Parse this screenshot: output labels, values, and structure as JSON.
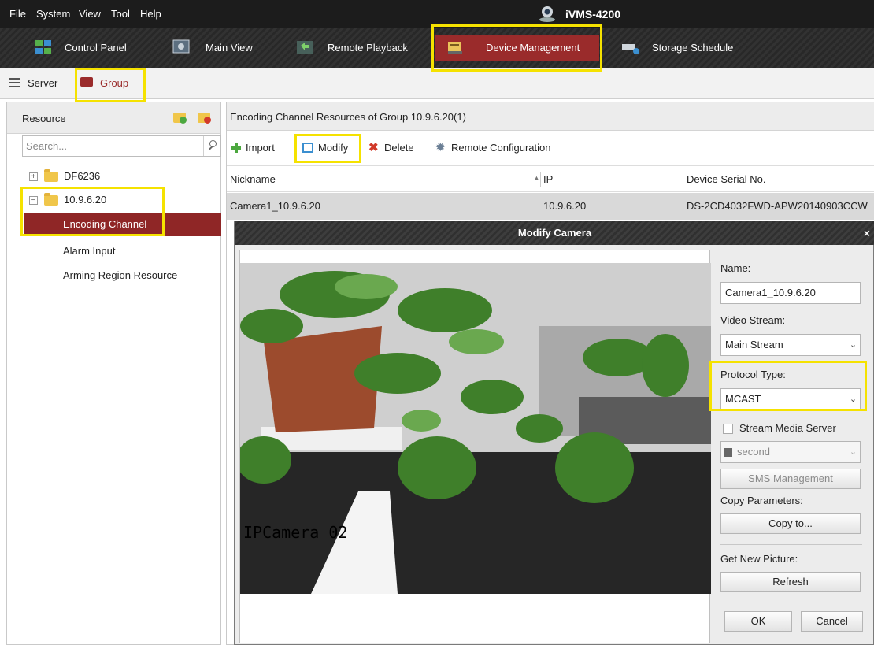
{
  "app": {
    "title": "iVMS-4200"
  },
  "menu": [
    "File",
    "System",
    "View",
    "Tool",
    "Help"
  ],
  "module_tabs": [
    {
      "label": "Control Panel"
    },
    {
      "label": "Main View"
    },
    {
      "label": "Remote Playback"
    },
    {
      "label": "Device Management"
    },
    {
      "label": "Storage Schedule"
    }
  ],
  "sub_tabs": [
    "Server",
    "Group"
  ],
  "left_panel": {
    "header": "Resource",
    "search_placeholder": "Search...",
    "tree": {
      "group1": "DF6236",
      "group2": "10.9.6.20",
      "children": [
        "Encoding Channel",
        "Alarm Input",
        "Arming Region Resource"
      ]
    }
  },
  "right_panel": {
    "header": "Encoding Channel Resources of Group 10.9.6.20(1)",
    "toolbar": {
      "import": "Import",
      "modify": "Modify",
      "delete": "Delete",
      "remote_config": "Remote Configuration"
    },
    "columns": {
      "nickname": "Nickname",
      "ip": "IP",
      "serial": "Device Serial No."
    },
    "row": {
      "nickname": "Camera1_10.9.6.20",
      "ip": "10.9.6.20",
      "serial": "DS-2CD4032FWD-APW20140903CCW"
    }
  },
  "modal": {
    "title": "Modify Camera",
    "close": "×",
    "osd_text": "IPCamera 02",
    "name_label": "Name:",
    "name_value": "Camera1_10.9.6.20",
    "video_stream_label": "Video Stream:",
    "video_stream_value": "Main Stream",
    "protocol_label": "Protocol Type:",
    "protocol_value": "MCAST",
    "sms_checkbox_label": "Stream Media Server",
    "sms_value": "second",
    "sms_button": "SMS Management",
    "copy_params_label": "Copy Parameters:",
    "copy_button": "Copy to...",
    "new_picture_label": "Get New Picture:",
    "refresh_button": "Refresh",
    "ok_button": "OK",
    "cancel_button": "Cancel"
  },
  "colors": {
    "accent_red": "#9a2b2b",
    "highlight_yellow": "#f5e200",
    "titlebar": "#1c1c1c"
  }
}
